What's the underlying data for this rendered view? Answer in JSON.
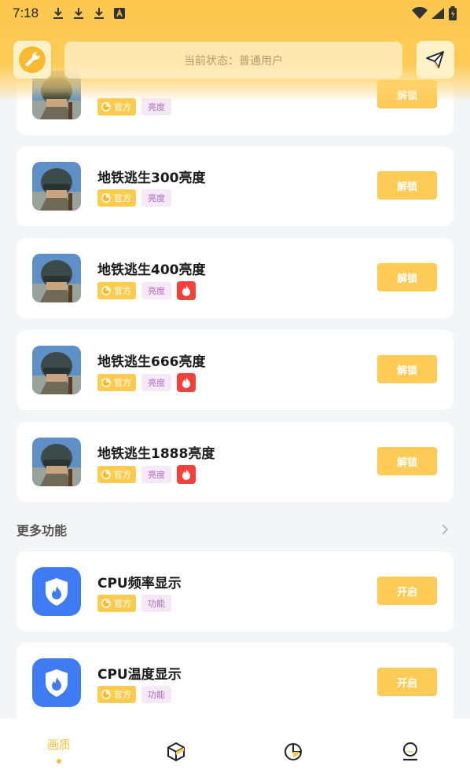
{
  "statusbar": {
    "time": "7:18"
  },
  "header": {
    "status_text": "当前状态：普通用户"
  },
  "cards": [
    {
      "title": "",
      "tags": {
        "official": "官方",
        "category": "亮度",
        "hot": false
      },
      "button": "解锁",
      "icon": "soldier-helmet-icon"
    },
    {
      "title": "地铁逃生300亮度",
      "tags": {
        "official": "官方",
        "category": "亮度",
        "hot": false
      },
      "button": "解锁",
      "icon": "soldier-helmet-icon"
    },
    {
      "title": "地铁逃生400亮度",
      "tags": {
        "official": "官方",
        "category": "亮度",
        "hot": true
      },
      "button": "解锁",
      "icon": "soldier-helmet-icon"
    },
    {
      "title": "地铁逃生666亮度",
      "tags": {
        "official": "官方",
        "category": "亮度",
        "hot": true
      },
      "button": "解锁",
      "icon": "soldier-helmet-icon"
    },
    {
      "title": "地铁逃生1888亮度",
      "tags": {
        "official": "官方",
        "category": "亮度",
        "hot": true
      },
      "button": "解锁",
      "icon": "soldier-helmet-icon"
    }
  ],
  "more": {
    "title": "更多功能",
    "items": [
      {
        "title": "CPU频率显示",
        "tags": {
          "official": "官方",
          "category": "功能"
        },
        "button": "开启",
        "icon": "shield-flame-icon"
      },
      {
        "title": "CPU温度显示",
        "tags": {
          "official": "官方",
          "category": "功能"
        },
        "button": "开启",
        "icon": "shield-flame-icon"
      }
    ]
  },
  "nav": {
    "items": [
      {
        "label": "画质",
        "active": true,
        "icon": ""
      },
      {
        "label": "",
        "active": false,
        "icon": "cube-icon"
      },
      {
        "label": "",
        "active": false,
        "icon": "pie-chart-icon"
      },
      {
        "label": "",
        "active": false,
        "icon": "user-icon"
      }
    ]
  },
  "colors": {
    "accent": "#fdcb56",
    "accent_dark": "#fdbe39",
    "hot": "#f5413b",
    "blue": "#3f7cf4"
  }
}
